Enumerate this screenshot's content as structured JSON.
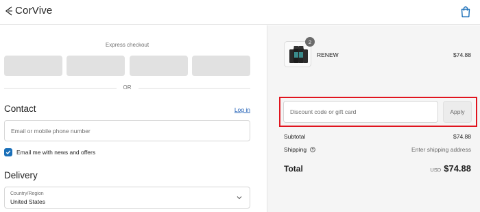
{
  "brand": {
    "name": "CorVive"
  },
  "header": {
    "cart_icon": "shopping-bag-icon"
  },
  "express": {
    "title": "Express checkout",
    "button_count": 4,
    "divider_text": "OR"
  },
  "contact": {
    "title": "Contact",
    "login_link": "Log in",
    "email_placeholder": "Email or mobile phone number",
    "email_value": "",
    "newsletter_label": "Email me with news and offers",
    "newsletter_checked": true
  },
  "delivery": {
    "title": "Delivery",
    "country_label": "Country/Region",
    "country_value": "United States"
  },
  "order": {
    "product_name": "RENEW",
    "product_quantity": "2",
    "product_price": "$74.88",
    "discount_placeholder": "Discount code or gift card",
    "discount_value": "",
    "apply_label": "Apply",
    "subtotal_label": "Subtotal",
    "subtotal_value": "$74.88",
    "shipping_label": "Shipping",
    "shipping_value": "Enter shipping address",
    "total_label": "Total",
    "currency": "USD",
    "total_value": "$74.88"
  },
  "colors": {
    "accent": "#1a6fb8",
    "link": "#1f5fb5",
    "highlight_box": "#e0141e",
    "summary_background": "#f5f5f5"
  }
}
